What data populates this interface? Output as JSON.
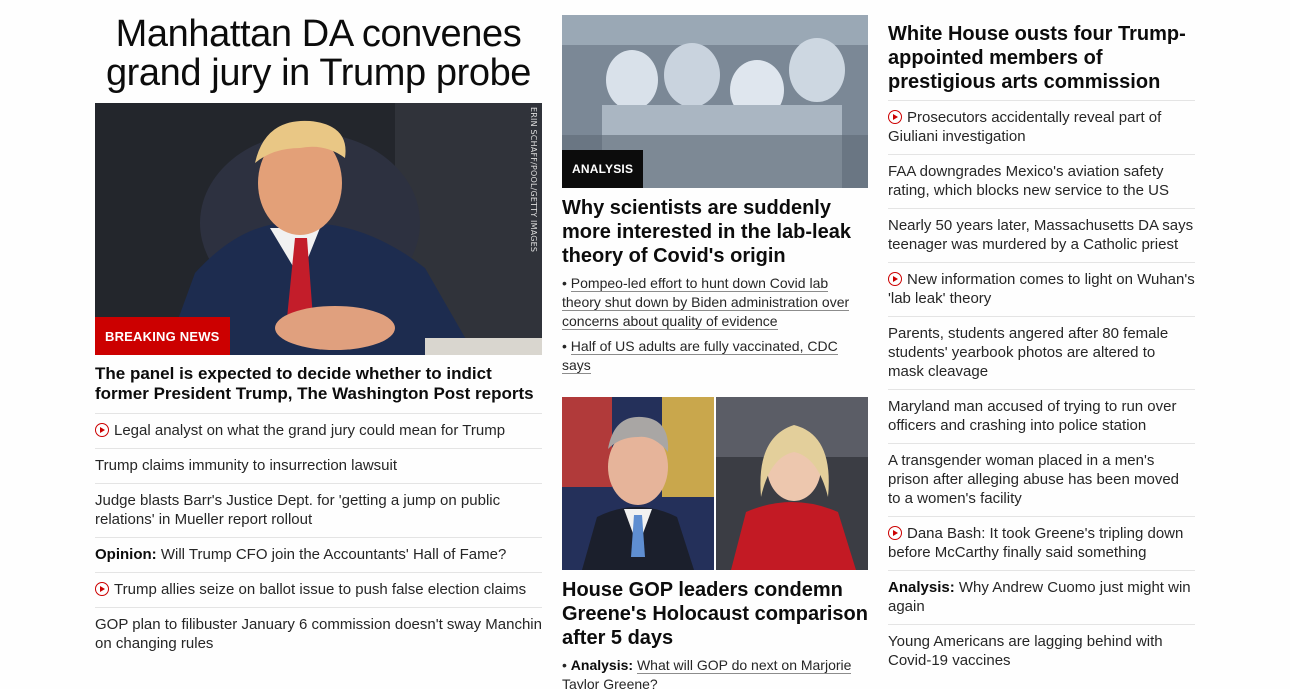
{
  "left": {
    "headline": "Manhattan DA convenes grand jury in Trump probe",
    "image_credit": "ERIN SCHAFF/POOL/GETTY IMAGES",
    "badge": "BREAKING NEWS",
    "subheadline": "The panel is expected to decide whether to indict former President Trump, The Washington Post reports",
    "items": [
      {
        "video": true,
        "prefix": "",
        "text": "Legal analyst on what the grand jury could mean for Trump"
      },
      {
        "video": false,
        "prefix": "",
        "text": "Trump claims immunity to insurrection lawsuit"
      },
      {
        "video": false,
        "prefix": "",
        "text": "Judge blasts Barr's Justice Dept. for 'getting a jump on public relations' in Mueller report rollout"
      },
      {
        "video": false,
        "prefix": "Opinion:",
        "text": "Will Trump CFO join the Accountants' Hall of Fame?"
      },
      {
        "video": true,
        "prefix": "",
        "text": "Trump allies seize on ballot issue to push false election claims"
      },
      {
        "video": false,
        "prefix": "",
        "text": "GOP plan to filibuster January 6 commission doesn't sway Manchin on changing rules"
      }
    ]
  },
  "middle": {
    "story1": {
      "badge": "ANALYSIS",
      "headline": "Why scientists are suddenly more interested in the lab-leak theory of Covid's origin",
      "bullets": [
        {
          "prefix": "",
          "text": "Pompeo-led effort to hunt down Covid lab theory shut down by Biden administration over concerns about quality of evidence"
        },
        {
          "prefix": "",
          "text": "Half of US adults are fully vaccinated, CDC says"
        }
      ]
    },
    "story2": {
      "headline": "House GOP leaders condemn Greene's Holocaust comparison after 5 days",
      "bullets": [
        {
          "prefix": "Analysis:",
          "text": "What will GOP do next on Marjorie Taylor Greene?"
        }
      ]
    }
  },
  "right": {
    "headline": "White House ousts four Trump-appointed members of prestigious arts commission",
    "items": [
      {
        "video": true,
        "prefix": "",
        "text": "Prosecutors accidentally reveal part of Giuliani investigation"
      },
      {
        "video": false,
        "prefix": "",
        "text": "FAA downgrades Mexico's aviation safety rating, which blocks new service to the US"
      },
      {
        "video": false,
        "prefix": "",
        "text": "Nearly 50 years later, Massachusetts DA says teenager was murdered by a Catholic priest"
      },
      {
        "video": true,
        "prefix": "",
        "text": "New information comes to light on Wuhan's 'lab leak' theory"
      },
      {
        "video": false,
        "prefix": "",
        "text": "Parents, students angered after 80 female students' yearbook photos are altered to mask cleavage"
      },
      {
        "video": false,
        "prefix": "",
        "text": "Maryland man accused of trying to run over officers and crashing into police station"
      },
      {
        "video": false,
        "prefix": "",
        "text": "A transgender woman placed in a men's prison after alleging abuse has been moved to a women's facility"
      },
      {
        "video": true,
        "prefix": "",
        "text": "Dana Bash: It took Greene's tripling down before McCarthy finally said something"
      },
      {
        "video": false,
        "prefix": "Analysis:",
        "text": "Why Andrew Cuomo just might win again"
      },
      {
        "video": false,
        "prefix": "",
        "text": "Young Americans are lagging behind with Covid-19 vaccines"
      }
    ]
  },
  "colors": {
    "breaking": "#cc0000",
    "analysis_badge": "#0c0c0c",
    "divider": "#e4e4e4"
  }
}
